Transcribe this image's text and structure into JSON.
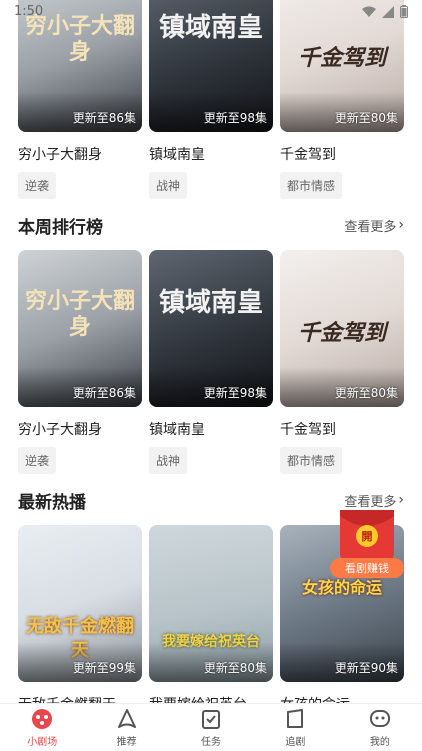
{
  "status_bar": {
    "time": "1:50"
  },
  "colors": {
    "accent": "#e5484d",
    "tag_bg": "#f2f2f2"
  },
  "row0": {
    "cards": [
      {
        "name": "穷小子大翻身",
        "update": "更新至86集",
        "tag": "逆袭",
        "art": "穷小子大翻身"
      },
      {
        "name": "镇域南皇",
        "update": "更新至98集",
        "tag": "战神",
        "art": "镇域南皇"
      },
      {
        "name": "千金驾到",
        "update": "更新至80集",
        "tag": "都市情感",
        "art": "千金驾到"
      }
    ]
  },
  "weekly": {
    "title": "本周排行榜",
    "more": "查看更多",
    "cards": [
      {
        "name": "穷小子大翻身",
        "update": "更新至86集",
        "tag": "逆袭",
        "art": "穷小子大翻身"
      },
      {
        "name": "镇域南皇",
        "update": "更新至98集",
        "tag": "战神",
        "art": "镇域南皇"
      },
      {
        "name": "千金驾到",
        "update": "更新至80集",
        "tag": "都市情感",
        "art": "千金驾到"
      }
    ]
  },
  "hot": {
    "title": "最新热播",
    "more": "查看更多",
    "cards": [
      {
        "name": "无敌千金燃翻天",
        "update": "更新至99集",
        "art": "无敌千金燃翻天"
      },
      {
        "name": "我要嫁给祝英台",
        "update": "更新至80集",
        "art": "我要嫁给祝英台"
      },
      {
        "name": "女孩的命运",
        "update": "更新至90集",
        "art": "女孩的命运"
      }
    ]
  },
  "floating_ad": {
    "top": "開",
    "label": "看剧赚钱"
  },
  "tabbar": {
    "items": [
      {
        "label": "小剧场",
        "icon": "theater-icon",
        "active": true
      },
      {
        "label": "推荐",
        "icon": "recommend-icon",
        "active": false
      },
      {
        "label": "任务",
        "icon": "task-icon",
        "active": false
      },
      {
        "label": "追剧",
        "icon": "follow-icon",
        "active": false
      },
      {
        "label": "我的",
        "icon": "profile-icon",
        "active": false
      }
    ]
  }
}
